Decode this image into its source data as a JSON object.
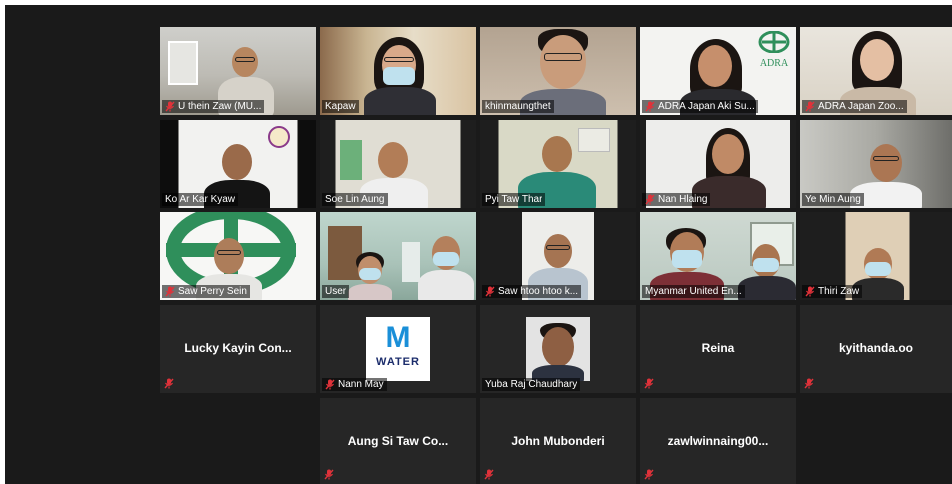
{
  "participants": [
    {
      "name": "U thein Zaw (MU...",
      "muted": true
    },
    {
      "name": "Kapaw",
      "muted": false
    },
    {
      "name": "khinmaungthet",
      "muted": false
    },
    {
      "name": "ADRA Japan Aki Su...",
      "muted": true
    },
    {
      "name": "ADRA Japan Zoo...",
      "muted": true
    },
    {
      "name": "Ko Ar Kar Kyaw",
      "muted": false
    },
    {
      "name": "Soe Lin Aung",
      "muted": false
    },
    {
      "name": "Pyi Taw Thar",
      "muted": false
    },
    {
      "name": "Nan Hlaing",
      "muted": true
    },
    {
      "name": "Ye Min Aung",
      "muted": false
    },
    {
      "name": "Saw Perry Sein",
      "muted": true
    },
    {
      "name": "User",
      "muted": false,
      "speaking": true
    },
    {
      "name": "Saw htoo htoo k...",
      "muted": true
    },
    {
      "name": "Myanmar United En...",
      "muted": false
    },
    {
      "name": "Thiri Zaw",
      "muted": true
    },
    {
      "name": "Lucky Kayin Con...",
      "muted": true
    },
    {
      "name": "Nann May",
      "muted": true
    },
    {
      "name": "Yuba Raj Chaudhary",
      "muted": false
    },
    {
      "name": "Reina",
      "muted": true
    },
    {
      "name": "kyithanda.oo",
      "muted": true
    },
    {
      "name": "Aung Si Taw Co...",
      "muted": true
    },
    {
      "name": "John Mubonderi",
      "muted": true
    },
    {
      "name": "zawlwinnaing00...",
      "muted": true
    }
  ],
  "logos": {
    "adra_text": "ADRA",
    "water_letter": "M",
    "water_text": "WATER"
  },
  "colors": {
    "mute_red": "#e0323a",
    "active_speaker": "#d8e04a",
    "adra_green": "#2f8f5b"
  }
}
